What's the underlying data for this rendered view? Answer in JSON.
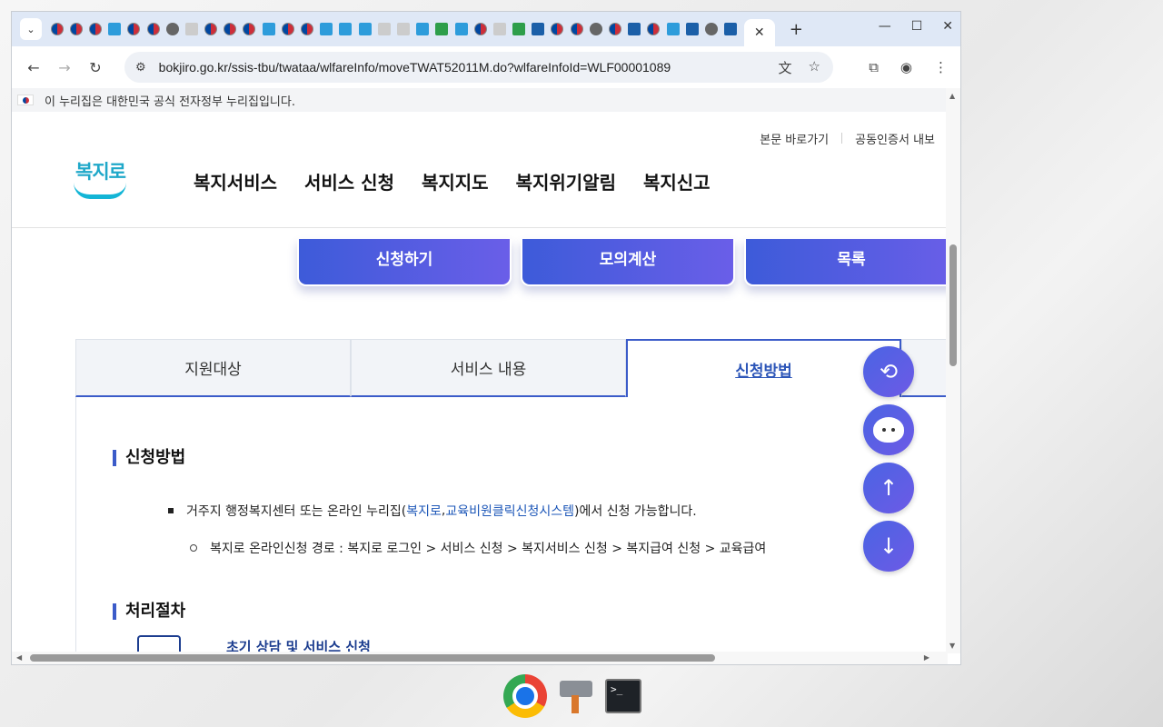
{
  "browser": {
    "active_tab_close": "✕",
    "new_tab": "+",
    "url": "bokjiro.go.kr/ssis-tbu/twataa/wlfareInfo/moveTWAT52011M.do?wlfareInfoId=WLF00001089"
  },
  "page": {
    "gov_banner": "이 누리집은 대한민국 공식 전자정부 누리집입니다.",
    "util_links": [
      "본문 바로가기",
      "공동인증서 내보"
    ],
    "logo_text": "복지로",
    "nav": [
      "복지서비스",
      "서비스 신청",
      "복지지도",
      "복지위기알림",
      "복지신고"
    ],
    "actions": [
      "신청하기",
      "모의계산",
      "목록"
    ],
    "tabs": [
      "지원대상",
      "서비스 내용",
      "신청방법"
    ],
    "section1_title": "신청방법",
    "bullet1": {
      "prefix": "거주지 행정복지센터 또는 온라인 누리집(",
      "link1": "복지로",
      "comma": ", ",
      "link2": "교육비원클릭신청시스템",
      "suffix": ")에서 신청 가능합니다."
    },
    "bullet2": "복지로 온라인신청 경로 : 복지로 로그인 > 서비스 신청 > 복지서비스 신청 > 복지급여 신청 > 교육급여",
    "section2_title": "처리절차",
    "step1_title": "초기 상담 및 서비스 신청"
  },
  "colors": {
    "accent": "#3b5bc9",
    "button_gradient_start": "#3d5bd9",
    "button_gradient_end": "#6a5ee8",
    "link": "#1d57b8"
  }
}
